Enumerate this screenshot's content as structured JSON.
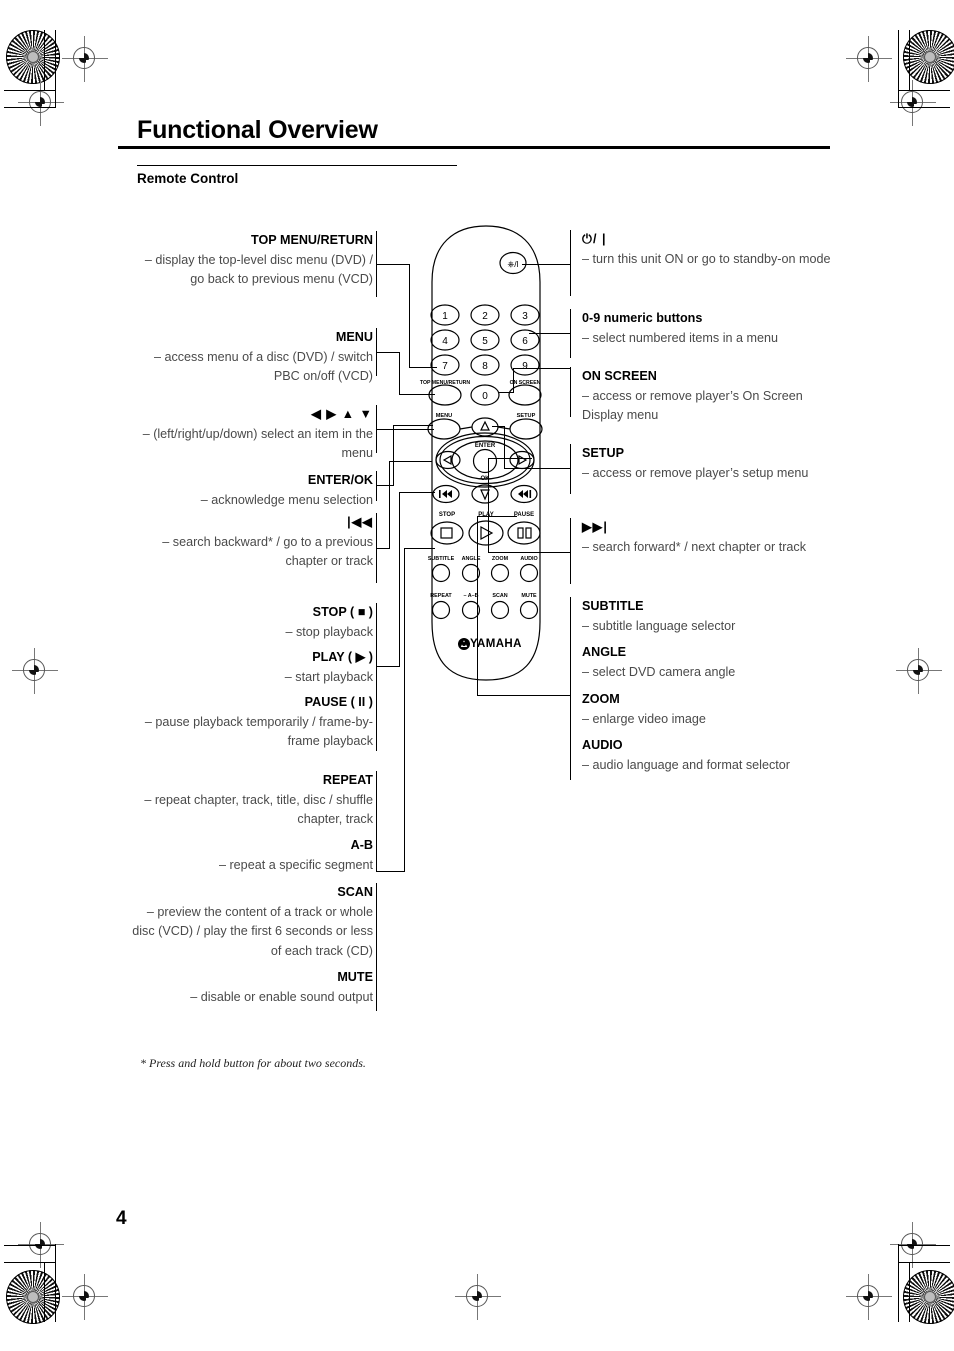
{
  "header": {
    "title": "Functional Overview",
    "section": "Remote Control"
  },
  "footnote": "* Press and hold button for about two seconds.",
  "page_number": "4",
  "left_callouts": [
    {
      "id": "top-menu-return",
      "title": "TOP MENU/RETURN",
      "desc": "– display the top-level disc menu (DVD) / go back to previous menu (VCD)"
    },
    {
      "id": "menu",
      "title": "MENU",
      "desc": "– access menu of a disc (DVD) / switch PBC on/off (VCD)"
    },
    {
      "id": "direction-pad",
      "title": "◀ ▶ ▲ ▼",
      "desc": "– (left/right/up/down) select an item in the menu"
    },
    {
      "id": "enter-ok",
      "title": "ENTER/OK",
      "desc": "– acknowledge menu selection"
    },
    {
      "id": "search-backward",
      "title": "|◀◀",
      "desc": "– search backward* / go to a previous chapter or track"
    },
    {
      "id": "stop",
      "title": "STOP ( ■ )",
      "desc": "– stop playback"
    },
    {
      "id": "play",
      "title": "PLAY ( ▶ )",
      "desc": "– start playback"
    },
    {
      "id": "pause",
      "title": "PAUSE ( II )",
      "desc": "– pause playback temporarily / frame-by-frame playback"
    },
    {
      "id": "repeat",
      "title": "REPEAT",
      "desc": "– repeat chapter, track, title, disc / shuffle chapter, track"
    },
    {
      "id": "a-b",
      "title": "A-B",
      "desc": "– repeat a specific segment"
    },
    {
      "id": "scan",
      "title": "SCAN",
      "desc": "– preview the content of a track or whole disc (VCD) / play the first 6 seconds or less of each track (CD)"
    },
    {
      "id": "mute",
      "title": "MUTE",
      "desc": "– disable or enable sound output"
    }
  ],
  "right_callouts": [
    {
      "id": "power",
      "title": "⏻/ |",
      "desc": "– turn this unit ON or go to standby-on mode"
    },
    {
      "id": "numeric",
      "title": "0-9 numeric buttons",
      "desc": "– select numbered items in a menu"
    },
    {
      "id": "on-screen",
      "title": "ON SCREEN",
      "desc": "– access or remove player’s On Screen Display menu"
    },
    {
      "id": "setup",
      "title": "SETUP",
      "desc": "– access or remove player’s setup menu"
    },
    {
      "id": "search-forward",
      "title": "▶▶|",
      "desc": "– search forward* / next chapter or track"
    },
    {
      "id": "subtitle",
      "title": "SUBTITLE",
      "desc": "– subtitle language selector"
    },
    {
      "id": "angle",
      "title": "ANGLE",
      "desc": "– select DVD camera angle"
    },
    {
      "id": "zoom",
      "title": "ZOOM",
      "desc": "– enlarge video image"
    },
    {
      "id": "audio",
      "title": "AUDIO",
      "desc": "– audio language and format selector"
    }
  ],
  "remote": {
    "brand": "YAMAHA",
    "power_label": "⏻/|",
    "numeric_keys": [
      "1",
      "2",
      "3",
      "4",
      "5",
      "6",
      "7",
      "8",
      "9",
      "0"
    ],
    "labels": {
      "top_menu_return": "TOP MENU/RETURN",
      "on_screen": "ON SCREEN",
      "menu": "MENU",
      "setup": "SETUP",
      "enter": "ENTER",
      "ok": "OK",
      "stop": "STOP",
      "play": "PLAY",
      "pause": "PAUSE",
      "subtitle": "SUBTITLE",
      "angle": "ANGLE",
      "zoom": "ZOOM",
      "audio": "AUDIO",
      "repeat": "REPEAT",
      "ab": "– A–B",
      "scan": "SCAN",
      "mute": "MUTE"
    }
  }
}
